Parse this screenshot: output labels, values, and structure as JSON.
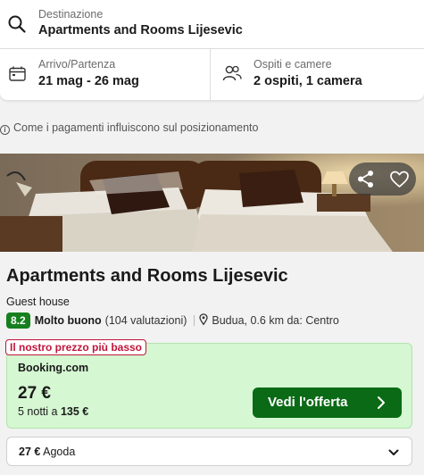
{
  "search": {
    "destination_label": "Destinazione",
    "destination_value": "Apartments and Rooms Lijesevic",
    "dates_label": "Arrivo/Partenza",
    "dates_value": "21 mag - 26 mag",
    "guests_label": "Ospiti e camere",
    "guests_value": "2 ospiti, 1 camera"
  },
  "info_text": "Come i pagamenti influiscono sul posizionamento",
  "hotel": {
    "name": "Apartments and Rooms Lijesevic",
    "type": "Guest house",
    "score": "8.2",
    "rating_word": "Molto buono",
    "reviews": "(104 valutazioni)",
    "location": "Budua, 0.6 km da: Centro"
  },
  "deal": {
    "badge": "Il nostro prezzo più basso",
    "provider": "Booking.com",
    "price": "27 €",
    "nights_prefix": "5 notti a",
    "nights_total": "135 €",
    "cta_label": "Vedi l'offerta"
  },
  "alternative": {
    "price": "27 €",
    "provider": "Agoda"
  },
  "icons": {
    "search": "search-icon",
    "calendar": "calendar-icon",
    "people": "people-icon",
    "info": "info-icon",
    "share": "share-icon",
    "heart": "heart-icon",
    "pin": "location-pin-icon",
    "arrow": "chevron-right-icon",
    "dropdown": "chevron-down-icon"
  },
  "colors": {
    "score_bg": "#16801f",
    "deal_bg": "#d5f7d2",
    "cta_bg": "#0b6a16",
    "badge_red": "#c0163a"
  }
}
